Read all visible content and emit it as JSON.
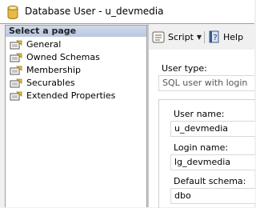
{
  "window": {
    "title": "Database User - u_devmedia"
  },
  "left_pane": {
    "header": "Select a page",
    "items": [
      {
        "label": "General",
        "icon": "page-icon"
      },
      {
        "label": "Owned Schemas",
        "icon": "page-icon"
      },
      {
        "label": "Membership",
        "icon": "page-icon"
      },
      {
        "label": "Securables",
        "icon": "page-icon"
      },
      {
        "label": "Extended Properties",
        "icon": "page-icon"
      }
    ]
  },
  "toolbar": {
    "script_label": "Script",
    "help_label": "Help"
  },
  "form": {
    "user_type_label": "User type:",
    "user_type_value": "SQL user with login",
    "user_name_label": "User name:",
    "user_name_value": "u_devmedia",
    "login_name_label": "Login name:",
    "login_name_value": "lg_devmedia",
    "default_schema_label": "Default schema:",
    "default_schema_value": "dbo"
  }
}
